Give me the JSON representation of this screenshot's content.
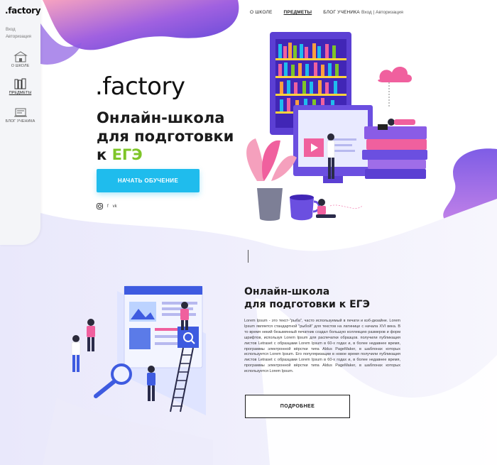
{
  "sidebar": {
    "logo": ".factory",
    "login": "Вход",
    "register": "Авторизация",
    "items": [
      {
        "label": "О ШКОЛЕ",
        "icon": "school-icon"
      },
      {
        "label": "ПРЕДМЕТЫ",
        "icon": "books-icon"
      },
      {
        "label": "БЛОГ УЧЕНИКА",
        "icon": "blog-icon"
      }
    ]
  },
  "topnav": {
    "items": [
      "О ШКОЛЕ",
      "ПРЕДМЕТЫ",
      "БЛОГ УЧЕНИКА"
    ],
    "auth": "Вход  |  Авторизация"
  },
  "hero": {
    "brand": ".factory",
    "title_line1": "Онлайн-школа",
    "title_line2": "для подготовки",
    "title_line3_prefix": "к ",
    "title_accent": "ЕГЭ",
    "cta": "НАЧАТЬ ОБУЧЕНИЕ",
    "socials": [
      "instagram-icon",
      "f",
      "vk"
    ]
  },
  "section": {
    "title_line1": "Онлайн-школа",
    "title_line2": "для подготовки к ЕГЭ",
    "body": "Lorem Ipsum - это текст-\"рыба\", часто используемый в печати и вэб-дизайне. Lorem Ipsum является стандартной \"рыбой\" для текстов на латинице с начала XVI века. В то время некий безымянный печатник создал большую коллекцию размеров и форм шрифтов, используя Lorem Ipsum для распечатки образцов. получили публикация листов Letraset с образцами Lorem Ipsum в 60-х годах и, в более недавнее время, программы электронной вёрстки типа Aldus PageMaker, в шаблонах которых используется Lorem Ipsum. Его популяризации в новое время получили публикация листов Letraset с образцами Lorem Ipsum в 60-х годах и, в более недавнее время, программы электронной вёрстки типа Aldus PageMaker, в шаблонах которых используется Lorem Ipsum.",
    "button": "ПОДРОБНЕЕ"
  },
  "colors": {
    "accent_blue": "#1fbced",
    "accent_green": "#7ec528",
    "purple": "#7b4fd8",
    "pink": "#f0609e"
  }
}
